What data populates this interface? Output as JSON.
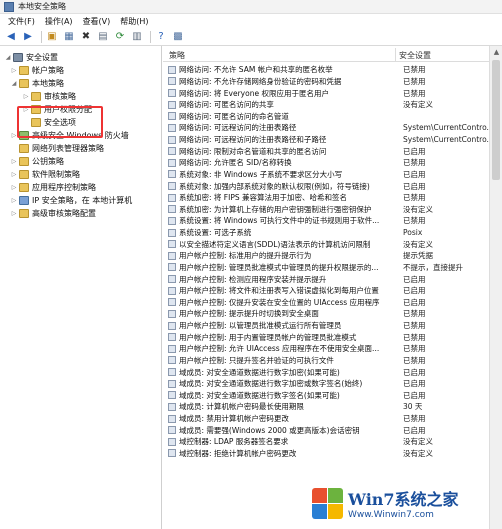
{
  "window": {
    "title": "本地安全策略"
  },
  "menu": [
    "文件(F)",
    "操作(A)",
    "查看(V)",
    "帮助(H)"
  ],
  "toolbar": {
    "icons": [
      "back-icon",
      "forward-icon",
      "up-icon",
      "show-tree-icon",
      "delete-icon",
      "properties-icon",
      "refresh-icon",
      "export-icon",
      "help-icon",
      "mmc-icon"
    ]
  },
  "tree": {
    "root": "安全设置",
    "items": [
      {
        "label": "帐户策略",
        "level": 1
      },
      {
        "label": "本地策略",
        "level": 1
      },
      {
        "label": "审核策略",
        "level": 2
      },
      {
        "label": "用户权限分配",
        "level": 2
      },
      {
        "label": "安全选项",
        "level": 2
      },
      {
        "label": "高级安全 Windows 防火墙",
        "level": 1
      },
      {
        "label": "网络列表管理器策略",
        "level": 1
      },
      {
        "label": "公钥策略",
        "level": 1
      },
      {
        "label": "软件限制策略",
        "level": 1
      },
      {
        "label": "应用程序控制策略",
        "level": 1
      },
      {
        "label": "IP 安全策略，在 本地计算机",
        "level": 1
      },
      {
        "label": "高级审核策略配置",
        "level": 1
      }
    ]
  },
  "list": {
    "col_policy": "策略",
    "col_setting": "安全设置",
    "rows": [
      {
        "policy": "网络访问: 不允许 SAM 帐户和共享的匿名枚举",
        "setting": "已禁用"
      },
      {
        "policy": "网络访问: 不允许存储网络身份验证的密码和凭据",
        "setting": "已禁用"
      },
      {
        "policy": "网络访问: 将 Everyone 权限应用于匿名用户",
        "setting": "已禁用"
      },
      {
        "policy": "网络访问: 可匿名访问的共享",
        "setting": "没有定义"
      },
      {
        "policy": "网络访问: 可匿名访问的命名管道",
        "setting": ""
      },
      {
        "policy": "网络访问: 可远程访问的注册表路径",
        "setting": "System\\CurrentContro..."
      },
      {
        "policy": "网络访问: 可远程访问的注册表路径和子路径",
        "setting": "System\\CurrentContro..."
      },
      {
        "policy": "网络访问: 限制对命名管道和共享的匿名访问",
        "setting": "已启用"
      },
      {
        "policy": "网络访问: 允许匿名 SID/名称转换",
        "setting": "已禁用"
      },
      {
        "policy": "系统对象: 非 Windows 子系统不要求区分大小写",
        "setting": "已启用"
      },
      {
        "policy": "系统对象: 加强内部系统对象的默认权限(例如，符号链接)",
        "setting": "已启用"
      },
      {
        "policy": "系统加密: 将 FIPS 兼容算法用于加密、哈希和签名",
        "setting": "已禁用"
      },
      {
        "policy": "系统加密: 为计算机上存储的用户密钥强制进行强密钥保护",
        "setting": "没有定义"
      },
      {
        "policy": "系统设置: 将 Windows 可执行文件中的证书规则用于软件...",
        "setting": "已禁用"
      },
      {
        "policy": "系统设置: 可选子系统",
        "setting": "Posix"
      },
      {
        "policy": "以安全描述符定义语言(SDDL)语法表示的计算机访问限制",
        "setting": "没有定义"
      },
      {
        "policy": "用户帐户控制: 标准用户的提升提示行为",
        "setting": "提示凭据"
      },
      {
        "policy": "用户帐户控制: 管理员批准模式中管理员的提升权限提示的...",
        "setting": "不提示，直接提升"
      },
      {
        "policy": "用户帐户控制: 检测应用程序安装并提示提升",
        "setting": "已启用"
      },
      {
        "policy": "用户帐户控制: 将文件和注册表写入错误虚拟化到每用户位置",
        "setting": "已启用"
      },
      {
        "policy": "用户帐户控制: 仅提升安装在安全位置的 UIAccess 应用程序",
        "setting": "已启用"
      },
      {
        "policy": "用户帐户控制: 提示提升时切换到安全桌面",
        "setting": "已禁用"
      },
      {
        "policy": "用户帐户控制: 以管理员批准模式运行所有管理员",
        "setting": "已禁用"
      },
      {
        "policy": "用户帐户控制: 用于内置管理员帐户的管理员批准模式",
        "setting": "已禁用"
      },
      {
        "policy": "用户帐户控制: 允许 UIAccess 应用程序在不使用安全桌面...",
        "setting": "已禁用"
      },
      {
        "policy": "用户帐户控制: 只提升签名并验证的可执行文件",
        "setting": "已禁用"
      },
      {
        "policy": "域成员: 对安全通道数据进行数字加密(如果可能)",
        "setting": "已启用"
      },
      {
        "policy": "域成员: 对安全通道数据进行数字加密或数字签名(始终)",
        "setting": "已启用"
      },
      {
        "policy": "域成员: 对安全通道数据进行数字签名(如果可能)",
        "setting": "已启用"
      },
      {
        "policy": "域成员: 计算机帐户密码最长使用期限",
        "setting": "30 天"
      },
      {
        "policy": "域成员: 禁用计算机帐户密码更改",
        "setting": "已禁用"
      },
      {
        "policy": "域成员: 需要强(Windows 2000 或更高版本)会话密钥",
        "setting": "已启用"
      },
      {
        "policy": "域控制器: LDAP 服务器签名要求",
        "setting": "没有定义"
      },
      {
        "policy": "域控制器: 拒绝计算机帐户密码更改",
        "setting": "没有定义"
      }
    ]
  },
  "watermark": {
    "main": "Win7系统之家",
    "sub": "Www.Winwin7.com"
  },
  "colors": {
    "highlight": "#e33333",
    "watermark": "#1a4f9c"
  }
}
